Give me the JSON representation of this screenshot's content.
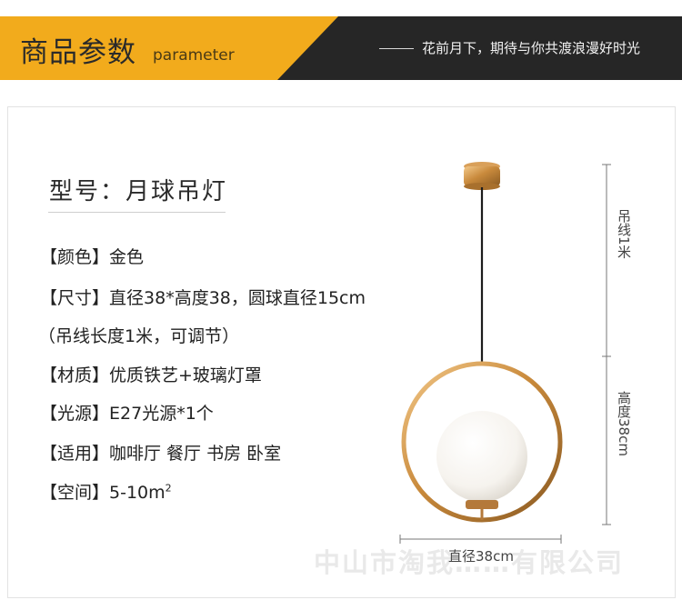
{
  "banner": {
    "title": "商品参数",
    "subtitle": "parameter",
    "slogan": "花前月下，期待与你共渡浪漫好时光",
    "colors": {
      "accent": "#f2ab1c",
      "dark": "#262626"
    }
  },
  "model": {
    "title": "型号：月球吊灯"
  },
  "specs": [
    {
      "label": "【颜色】",
      "value": "金色"
    },
    {
      "label": "【尺寸】",
      "value": "直径38*高度38，圆球直径15cm"
    },
    {
      "label": "",
      "value": "（吊线长度1米，可调节）"
    },
    {
      "label": "【材质】",
      "value": "优质铁艺+玻璃灯罩"
    },
    {
      "label": "【光源】",
      "value": "E27光源*1个"
    },
    {
      "label": "【适用】",
      "value": "咖啡厅 餐厅 书房 卧室"
    },
    {
      "label": "【空间】",
      "value": "5-10m",
      "sup": "2"
    }
  ],
  "dimensions": {
    "cord": "吊线1米",
    "height": "高度38cm",
    "diameter": "直径38cm"
  },
  "watermark": "中山市淘我……有限公司"
}
